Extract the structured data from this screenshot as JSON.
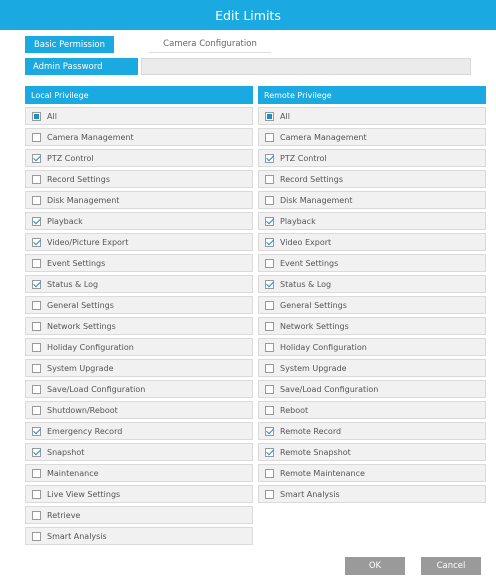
{
  "title": "Edit Limits",
  "tabs": {
    "basic": "Basic Permission",
    "camera": "Camera Configuration"
  },
  "admin_password_label": "Admin Password",
  "local": {
    "header": "Local Privilege",
    "items": [
      {
        "label": "All",
        "state": "partial"
      },
      {
        "label": "Camera Management",
        "state": "unchecked"
      },
      {
        "label": "PTZ Control",
        "state": "checked"
      },
      {
        "label": "Record Settings",
        "state": "unchecked"
      },
      {
        "label": "Disk Management",
        "state": "unchecked"
      },
      {
        "label": "Playback",
        "state": "checked"
      },
      {
        "label": "Video/Picture Export",
        "state": "checked"
      },
      {
        "label": "Event Settings",
        "state": "unchecked"
      },
      {
        "label": "Status & Log",
        "state": "checked"
      },
      {
        "label": "General Settings",
        "state": "unchecked"
      },
      {
        "label": "Network Settings",
        "state": "unchecked"
      },
      {
        "label": "Holiday Configuration",
        "state": "unchecked"
      },
      {
        "label": "System Upgrade",
        "state": "unchecked"
      },
      {
        "label": "Save/Load Configuration",
        "state": "unchecked"
      },
      {
        "label": "Shutdown/Reboot",
        "state": "unchecked"
      },
      {
        "label": "Emergency Record",
        "state": "checked"
      },
      {
        "label": "Snapshot",
        "state": "checked"
      },
      {
        "label": "Maintenance",
        "state": "unchecked"
      },
      {
        "label": "Live View Settings",
        "state": "unchecked"
      },
      {
        "label": "Retrieve",
        "state": "unchecked"
      },
      {
        "label": "Smart Analysis",
        "state": "unchecked"
      }
    ]
  },
  "remote": {
    "header": "Remote Privilege",
    "items": [
      {
        "label": "All",
        "state": "partial"
      },
      {
        "label": "Camera Management",
        "state": "unchecked"
      },
      {
        "label": "PTZ Control",
        "state": "checked"
      },
      {
        "label": "Record Settings",
        "state": "unchecked"
      },
      {
        "label": "Disk Management",
        "state": "unchecked"
      },
      {
        "label": "Playback",
        "state": "checked"
      },
      {
        "label": "Video Export",
        "state": "checked"
      },
      {
        "label": "Event Settings",
        "state": "unchecked"
      },
      {
        "label": "Status & Log",
        "state": "checked"
      },
      {
        "label": "General Settings",
        "state": "unchecked"
      },
      {
        "label": "Network Settings",
        "state": "unchecked"
      },
      {
        "label": "Holiday Configuration",
        "state": "unchecked"
      },
      {
        "label": "System Upgrade",
        "state": "unchecked"
      },
      {
        "label": "Save/Load Configuration",
        "state": "unchecked"
      },
      {
        "label": "Reboot",
        "state": "unchecked"
      },
      {
        "label": "Remote Record",
        "state": "checked"
      },
      {
        "label": "Remote Snapshot",
        "state": "checked"
      },
      {
        "label": "Remote Maintenance",
        "state": "unchecked"
      },
      {
        "label": "Smart Analysis",
        "state": "unchecked"
      }
    ]
  },
  "buttons": {
    "ok": "OK",
    "cancel": "Cancel"
  },
  "colors": {
    "accent": "#1aa9e0",
    "button": "#9a9a9a"
  }
}
